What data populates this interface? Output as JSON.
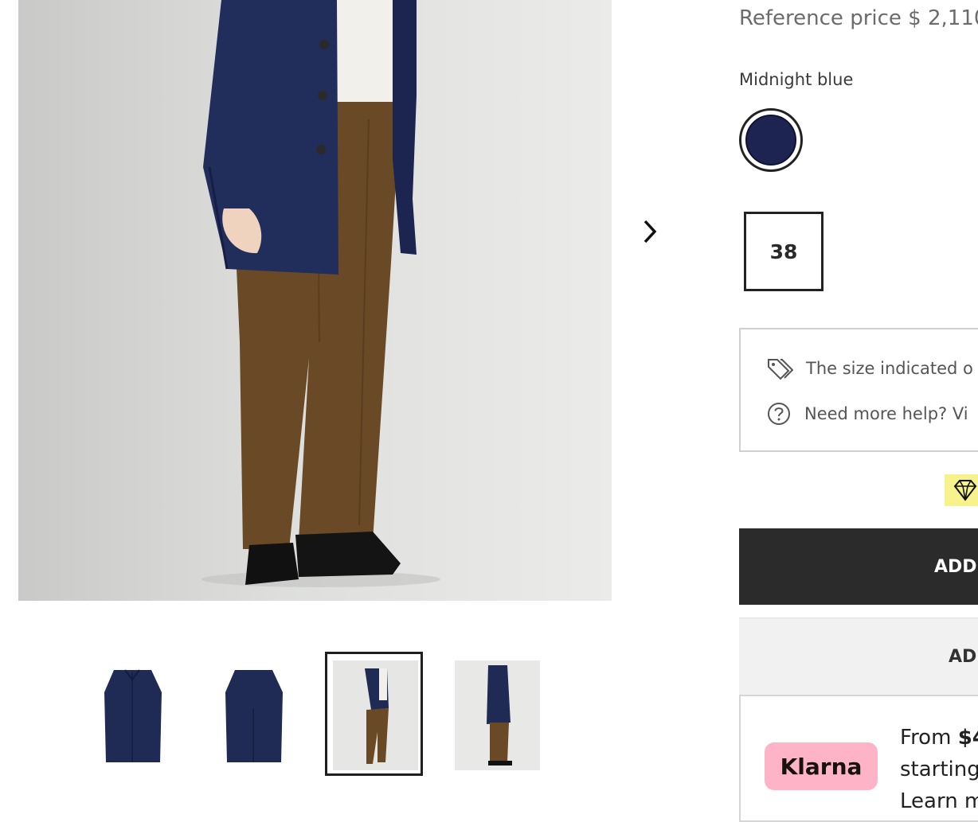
{
  "price": {
    "reference": "Reference price $ 2,110"
  },
  "color": {
    "label": "Midnight blue",
    "swatch_hex": "#1e2452"
  },
  "size": {
    "selected": "38"
  },
  "info": {
    "size_note": "The size indicated o",
    "help": "Need more help? Vi"
  },
  "buttons": {
    "add_to_cart": "ADD",
    "add_wishlist": "AD"
  },
  "klarna": {
    "logo": "Klarna",
    "line1_prefix": "From ",
    "line1_amount": "$4",
    "line2": "starting",
    "line3": "Learn m"
  },
  "gallery": {
    "thumbnails": [
      "front-flat",
      "back-flat",
      "model-front",
      "model-side"
    ],
    "selected_index": 2
  },
  "icons": {
    "next": "chevron-right-icon",
    "tag": "tags-icon",
    "help": "question-circle-icon",
    "gem": "diamond-icon"
  }
}
